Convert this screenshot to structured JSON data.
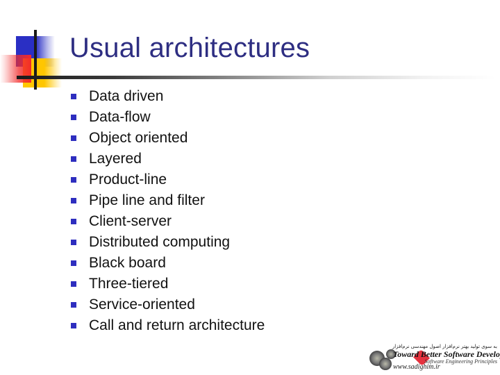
{
  "slide": {
    "title": "Usual architectures",
    "bullet_color": "#2e2ebf",
    "title_color": "#2e2e82",
    "items": [
      {
        "label": "Data driven"
      },
      {
        "label": "Data-flow"
      },
      {
        "label": "Object oriented"
      },
      {
        "label": "Layered"
      },
      {
        "label": "Product-line"
      },
      {
        "label": "Pipe line and filter"
      },
      {
        "label": "Client-server"
      },
      {
        "label": "Distributed computing"
      },
      {
        "label": "Black board"
      },
      {
        "label": "Three-tiered"
      },
      {
        "label": "Service-oriented"
      },
      {
        "label": "Call and return architecture"
      }
    ]
  },
  "footer": {
    "persian_line": "به سوی تولید بهتر نرم‌افزار اصول مهندسی نرم‌افزار",
    "main": "Toward Better Software Development;",
    "sub": "Software Engineering Principles",
    "url": "www.sadighim.ir"
  },
  "decoration": {
    "accent_blue": "#2a2fc4",
    "accent_yellow": "#ffc600",
    "accent_red": "#f22a2a"
  }
}
